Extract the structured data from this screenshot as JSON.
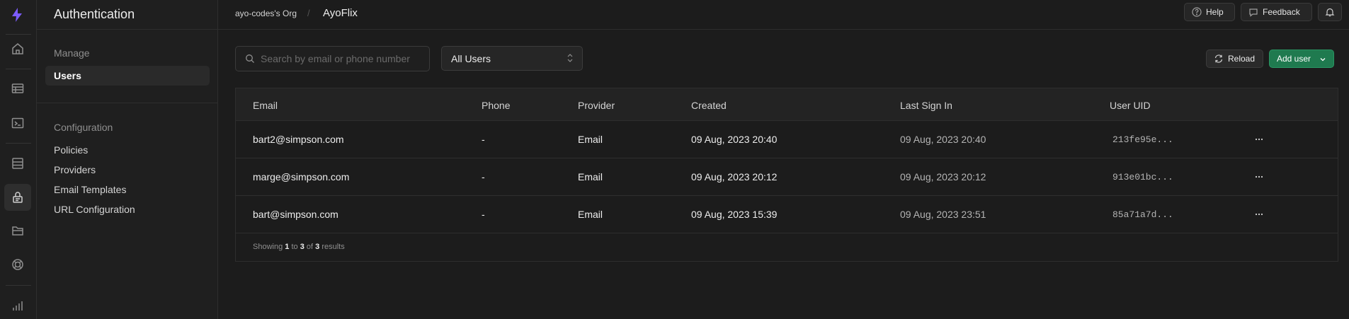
{
  "menu": {
    "title": "Authentication",
    "manage_label": "Manage",
    "users_label": "Users",
    "configuration_label": "Configuration",
    "config_items": [
      "Policies",
      "Providers",
      "Email Templates",
      "URL Configuration"
    ]
  },
  "topbar": {
    "org": "ayo-codes's Org",
    "separator": "/",
    "project": "AyoFlix",
    "help_label": "Help",
    "feedback_label": "Feedback"
  },
  "filters": {
    "search_placeholder": "Search by email or phone number",
    "select_value": "All Users",
    "reload_label": "Reload",
    "add_user_label": "Add user"
  },
  "table": {
    "columns": [
      "Email",
      "Phone",
      "Provider",
      "Created",
      "Last Sign In",
      "User UID"
    ],
    "rows": [
      {
        "email": "bart2@simpson.com",
        "phone": "-",
        "provider": "Email",
        "created": "09 Aug, 2023 20:40",
        "last_sign_in": "09 Aug, 2023 20:40",
        "uid": "213fe95e..."
      },
      {
        "email": "marge@simpson.com",
        "phone": "-",
        "provider": "Email",
        "created": "09 Aug, 2023 20:12",
        "last_sign_in": "09 Aug, 2023 20:12",
        "uid": "913e01bc..."
      },
      {
        "email": "bart@simpson.com",
        "phone": "-",
        "provider": "Email",
        "created": "09 Aug, 2023 15:39",
        "last_sign_in": "09 Aug, 2023 23:51",
        "uid": "85a71a7d..."
      }
    ],
    "footer": {
      "showing": "Showing",
      "from": "1",
      "to_word": "to",
      "to": "3",
      "of_word": "of",
      "total": "3",
      "results": "results"
    }
  },
  "rail_icons": [
    "supabase-logo-icon",
    "home-icon",
    "table-editor-icon",
    "sql-editor-icon",
    "database-icon",
    "auth-lock-icon",
    "storage-folder-icon",
    "edge-functions-icon",
    "reports-chart-icon"
  ],
  "colors": {
    "accent": "#3ecf8e",
    "add_button": "#1f7a4f",
    "logo": "#7c5cff"
  }
}
